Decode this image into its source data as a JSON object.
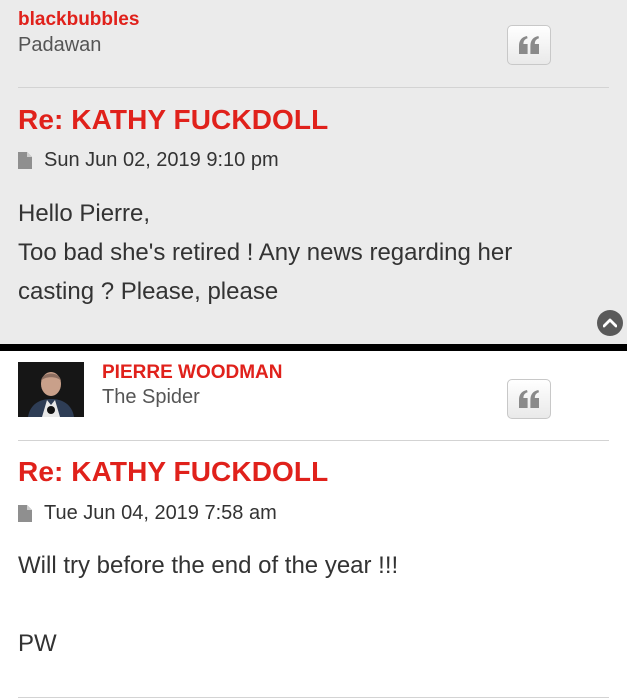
{
  "posts": [
    {
      "username": "blackbubbles",
      "rank": "Padawan",
      "title": "Re: KATHY FUCKDOLL",
      "timestamp": "Sun Jun 02, 2019 9:10 pm",
      "content_lines": [
        "Hello Pierre,",
        "Too bad she's retired ! Any news regarding her",
        "casting ? Please, please"
      ]
    },
    {
      "username": "PIERRE WOODMAN",
      "rank": "The Spider",
      "title": "Re: KATHY FUCKDOLL",
      "timestamp": "Tue Jun 04, 2019 7:58 am",
      "content_lines": [
        "Will try before the end of the year !!!",
        "",
        "PW"
      ]
    }
  ],
  "colors": {
    "accent": "#e0211b",
    "post_bg_alt": "#ebebeb",
    "text": "#333333"
  },
  "icons": {
    "quote": "quote-icon",
    "file": "file-icon",
    "back_to_top": "chevron-up-icon"
  }
}
